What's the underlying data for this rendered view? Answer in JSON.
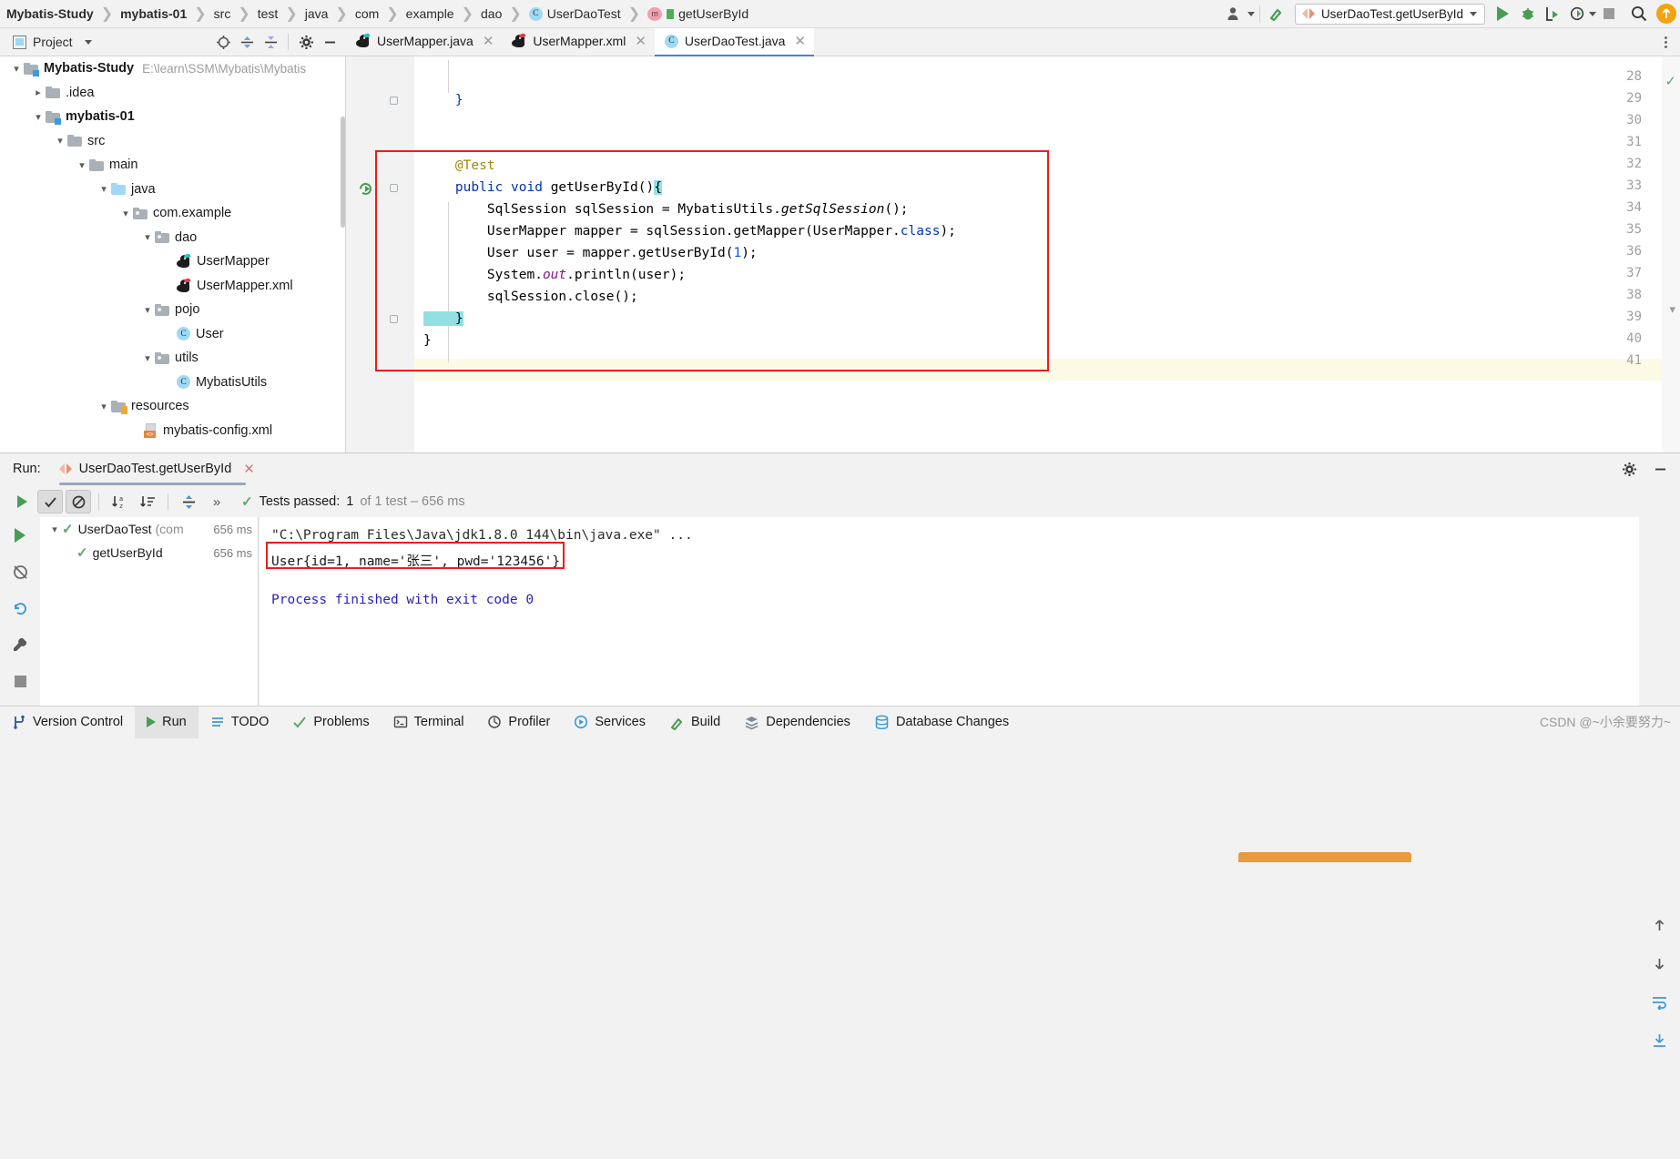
{
  "window": {
    "ide": "IntelliJ IDEA",
    "project_name": "Mybatis-Study"
  },
  "breadcrumb": {
    "items": [
      {
        "label": "Mybatis-Study",
        "bold": true,
        "icon": "none"
      },
      {
        "label": "mybatis-01",
        "bold": true,
        "icon": "none"
      },
      {
        "label": "src",
        "bold": false,
        "icon": "none"
      },
      {
        "label": "test",
        "bold": false,
        "icon": "none"
      },
      {
        "label": "java",
        "bold": false,
        "icon": "none"
      },
      {
        "label": "com",
        "bold": false,
        "icon": "none"
      },
      {
        "label": "example",
        "bold": false,
        "icon": "none"
      },
      {
        "label": "dao",
        "bold": false,
        "icon": "none"
      },
      {
        "label": "UserDaoTest",
        "bold": false,
        "icon": "class-icon"
      },
      {
        "label": "getUserById",
        "bold": false,
        "icon": "method-icon"
      }
    ],
    "separator": "❯"
  },
  "toolbar": {
    "account_icon": "user-account-icon",
    "build_icon": "hammer-icon",
    "run_config": {
      "icon": "junit-icon",
      "label": "UserDaoTest.getUserById",
      "dropdown": "▾"
    },
    "run_icon": "run-icon",
    "debug_icon": "debug-icon",
    "run_coverage_icon": "run-with-coverage-icon",
    "profiler_icon": "profiler-icon",
    "stop_icon": "stop-icon",
    "search_icon": "search-everywhere-icon",
    "update_icon": "update-project-icon"
  },
  "project_panel": {
    "title": "Project",
    "dropdown": "▾",
    "icons": [
      "locate-icon",
      "expand-all-icon",
      "collapse-all-icon",
      "settings-icon",
      "hide-icon"
    ],
    "tree": [
      {
        "depth": 0,
        "label": "Mybatis-Study",
        "path": "E:\\learn\\SSM\\Mybatis\\Mybatis",
        "icon": "module-folder-icon",
        "chevron": "down",
        "bold": true
      },
      {
        "depth": 1,
        "label": ".idea",
        "icon": "folder-icon",
        "chevron": "right",
        "bold": false
      },
      {
        "depth": 1,
        "label": "mybatis-01",
        "icon": "module-folder-icon",
        "chevron": "down",
        "bold": true
      },
      {
        "depth": 2,
        "label": "src",
        "icon": "folder-icon",
        "chevron": "down",
        "bold": false
      },
      {
        "depth": 3,
        "label": "main",
        "icon": "folder-icon",
        "chevron": "down",
        "bold": false
      },
      {
        "depth": 4,
        "label": "java",
        "icon": "source-folder-icon",
        "chevron": "down",
        "bold": false
      },
      {
        "depth": 5,
        "label": "com.example",
        "icon": "package-icon",
        "chevron": "down",
        "bold": false
      },
      {
        "depth": 6,
        "label": "dao",
        "icon": "package-icon",
        "chevron": "down",
        "bold": false
      },
      {
        "depth": 7,
        "label": "UserMapper",
        "icon": "mybatis-mapper-icon",
        "chevron": "none",
        "bold": false
      },
      {
        "depth": 7,
        "label": "UserMapper.xml",
        "icon": "mybatis-xml-icon",
        "chevron": "none",
        "bold": false
      },
      {
        "depth": 6,
        "label": "pojo",
        "icon": "package-icon",
        "chevron": "down",
        "bold": false
      },
      {
        "depth": 7,
        "label": "User",
        "icon": "class-icon",
        "chevron": "none",
        "bold": false
      },
      {
        "depth": 6,
        "label": "utils",
        "icon": "package-icon",
        "chevron": "down",
        "bold": false
      },
      {
        "depth": 7,
        "label": "MybatisUtils",
        "icon": "class-icon",
        "chevron": "none",
        "bold": false
      },
      {
        "depth": 4,
        "label": "resources",
        "icon": "resources-folder-icon",
        "chevron": "down",
        "bold": false
      },
      {
        "depth": 5,
        "label": "mybatis-config.xml",
        "icon": "xml-file-icon",
        "chevron": "none",
        "bold": false
      }
    ]
  },
  "editor": {
    "tabs": [
      {
        "label": "UserMapper.java",
        "icon": "mybatis-mapper-icon",
        "active": false,
        "closable": true
      },
      {
        "label": "UserMapper.xml",
        "icon": "mybatis-xml-icon",
        "active": false,
        "closable": true
      },
      {
        "label": "UserDaoTest.java",
        "icon": "class-icon",
        "active": true,
        "closable": true
      }
    ],
    "line_numbers": [
      "28",
      "29",
      "30",
      "31",
      "32",
      "33",
      "34",
      "35",
      "36",
      "37",
      "38",
      "39",
      "40",
      "41"
    ],
    "lines": [
      {
        "n": "29",
        "text": "}"
      },
      {
        "n": "32",
        "text": "@Test"
      },
      {
        "n": "33",
        "text": "public void getUserById(){"
      },
      {
        "n": "34",
        "text": "SqlSession sqlSession = MybatisUtils.getSqlSession();"
      },
      {
        "n": "35",
        "text": "UserMapper mapper = sqlSession.getMapper(UserMapper.class);"
      },
      {
        "n": "36",
        "text": "User user = mapper.getUserById(1);"
      },
      {
        "n": "37",
        "text": "System.out.println(user);"
      },
      {
        "n": "38",
        "text": "sqlSession.close();"
      },
      {
        "n": "39",
        "text": "}"
      },
      {
        "n": "40",
        "text": "}"
      }
    ],
    "highlight_box_color": "#ef1b1b",
    "inspection_status": "ok"
  },
  "run_panel": {
    "label": "Run:",
    "tab": {
      "icon": "junit-icon",
      "label": "UserDaoTest.getUserById",
      "close": "✕"
    },
    "toolbar": {
      "rerun_icon": "rerun-icon",
      "show_passed_icon": "show-passed-icon",
      "hide_ignored_icon": "hide-ignored-icon",
      "sort_alpha_icon": "sort-alphabetically-icon",
      "sort_duration_icon": "sort-by-duration-icon",
      "expand_icon": "expand-all-icon",
      "more_icon": "more-icon",
      "settings_icon": "gear-icon",
      "minimize_icon": "minimize-icon"
    },
    "status": {
      "icon": "test-passed-icon",
      "prefix": "Tests passed:",
      "count": "1",
      "suffix": "of 1 test – 656 ms"
    },
    "left_tools": [
      "run-icon",
      "coverage-icon",
      "rerun-failed-icon",
      "settings-wrench-icon",
      "stop-icon",
      "expand-icon"
    ],
    "test_tree": [
      {
        "depth": 0,
        "icon": "test-passed-icon",
        "name": "UserDaoTest",
        "sub": "(com",
        "duration": "656 ms",
        "chevron": "down"
      },
      {
        "depth": 1,
        "icon": "test-passed-icon",
        "name": "getUserById",
        "sub": "",
        "duration": "656 ms",
        "chevron": "none"
      }
    ],
    "console": [
      {
        "text": "\"C:\\Program Files\\Java\\jdk1.8.0_144\\bin\\java.exe\" ...",
        "style": "command"
      },
      {
        "text": "User{id=1, name='张三', pwd='123456'}",
        "style": "output",
        "highlighted": true
      },
      {
        "text": "Process finished with exit code 0",
        "style": "finished"
      }
    ],
    "console_highlight_color": "#ef1b1b",
    "right_rail": [
      "scroll-up-icon",
      "scroll-down-icon",
      "soft-wrap-icon",
      "scroll-to-end-icon"
    ]
  },
  "status_bar": {
    "items": [
      {
        "label": "Version Control",
        "icon": "version-control-icon",
        "active": false
      },
      {
        "label": "Run",
        "icon": "run-icon",
        "active": true
      },
      {
        "label": "TODO",
        "icon": "todo-icon",
        "active": false
      },
      {
        "label": "Problems",
        "icon": "problems-icon",
        "active": false
      },
      {
        "label": "Terminal",
        "icon": "terminal-icon",
        "active": false
      },
      {
        "label": "Profiler",
        "icon": "profiler-icon",
        "active": false
      },
      {
        "label": "Services",
        "icon": "services-icon",
        "active": false
      },
      {
        "label": "Build",
        "icon": "build-icon",
        "active": false
      },
      {
        "label": "Dependencies",
        "icon": "dependencies-icon",
        "active": false
      },
      {
        "label": "Database Changes",
        "icon": "database-changes-icon",
        "active": false
      }
    ],
    "watermark": "CSDN @~小余要努力~"
  },
  "colors": {
    "accent_blue": "#4b7fd6",
    "keyword": "#0033b3",
    "annotation": "#9e880d",
    "number": "#1750eb",
    "static_field": "#871094",
    "pass_green": "#59a869",
    "highlight_red": "#ef1b1b",
    "current_line": "#fcfae5"
  }
}
